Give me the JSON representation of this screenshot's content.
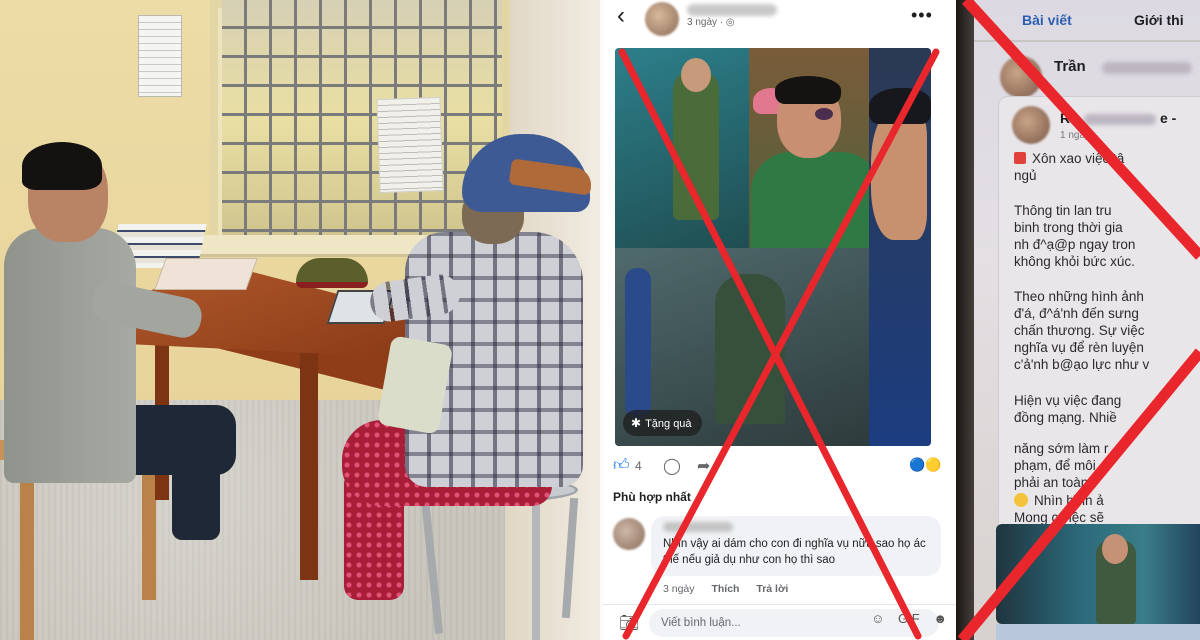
{
  "post": {
    "time": "3 ngày · ",
    "gift_label": "Tặng quà",
    "like_count": "4",
    "filter_label": "Phù hợp nhất",
    "comment": {
      "text": "Nhìn vậy ai dám cho con đi nghĩa vụ nữa sao họ ác thế nếu giả dụ như con họ thì sao",
      "time": "3 ngày",
      "like": "Thích",
      "reply": "Trả lời"
    },
    "compose_placeholder": "Viết bình luận...",
    "compose_gif": "GIF"
  },
  "article": {
    "tab_posts": "Bài viết",
    "tab_intro": "Giới thi",
    "author": "Trần",
    "sharer_prefix": "Ro",
    "sharer_suffix": "e -",
    "time_small": "1 ngày",
    "lines": [
      "Xôn xao việc tâ",
      "ngủ",
      "Thông tin lan tru",
      "binh trong thời gia",
      "nh đ^ạ@p ngay tron",
      "không khỏi bức xúc.",
      "Theo những hình ảnh",
      "đ'á, đ^á'nh đến sưng",
      "chấn thương. Sự việc",
      "nghĩa vụ để rèn luyện",
      "c'ả'nh b@ạo lực như v",
      "Hiện vụ việc đang",
      "đồng mạng. Nhiề",
      "năng sớm làm r",
      "phạm, để môi",
      "phải an toàn",
      "Nhìn    hình ả",
      "Mong c    việc sẽ"
    ]
  },
  "colors": {
    "x_red": "#e8262b",
    "fb_blue": "#1877f2"
  }
}
